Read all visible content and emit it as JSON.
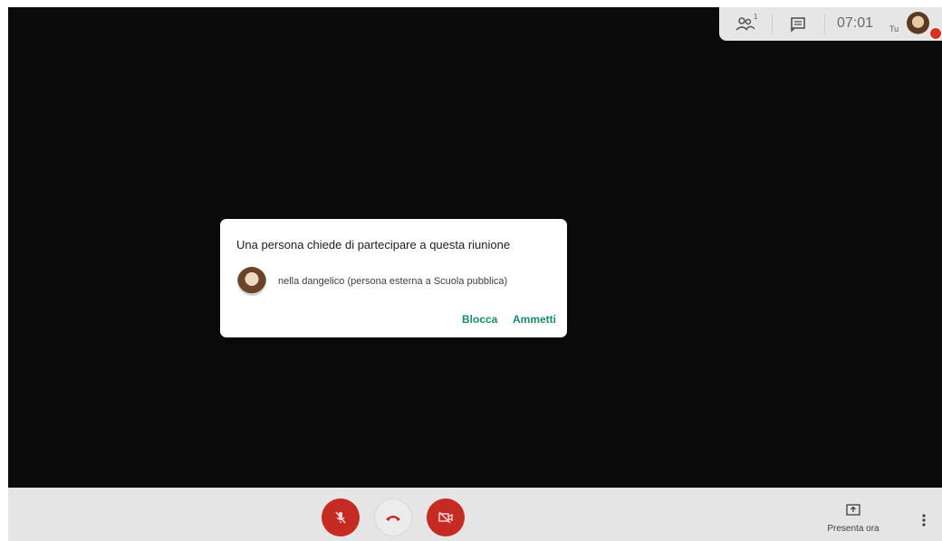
{
  "topbar": {
    "participants_icon": "people-icon",
    "participants_count": "1",
    "chat_icon": "chat-icon",
    "time": "07:01",
    "self_label": "Tu"
  },
  "dialog": {
    "title": "Una persona chiede di partecipare a questa riunione",
    "requester": "nella dangelico (persona esterna a Scuola pubblica)",
    "block_label": "Blocca",
    "admit_label": "Ammetti"
  },
  "controls": {
    "mic_icon": "mic-off-icon",
    "hangup_icon": "hang-up-icon",
    "camera_icon": "camera-off-icon",
    "present_icon": "present-screen-icon",
    "present_label": "Presenta ora",
    "more_icon": "more-vert-icon"
  },
  "colors": {
    "accent": "#1a8a6e",
    "danger": "#c52b22",
    "stage": "#0b0b0b"
  }
}
